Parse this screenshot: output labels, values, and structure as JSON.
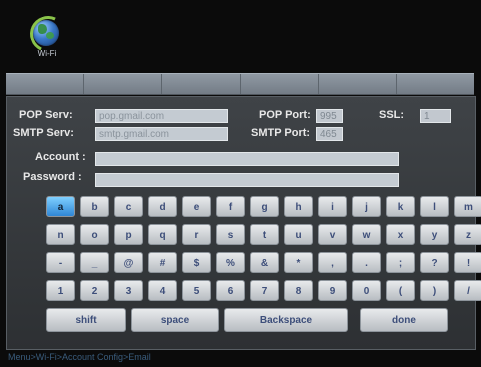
{
  "logo": {
    "label": "Wi-Fi"
  },
  "tabs": [
    "",
    "",
    "",
    "",
    "",
    ""
  ],
  "form": {
    "pop_serv_label": "POP Serv:",
    "pop_serv_value": "pop.gmail.com",
    "smtp_serv_label": "SMTP Serv:",
    "smtp_serv_value": "smtp.gmail.com",
    "pop_port_label": "POP Port:",
    "pop_port_value": "995",
    "smtp_port_label": "SMTP Port:",
    "smtp_port_value": "465",
    "ssl_label": "SSL:",
    "ssl_value": "1",
    "account_label": "Account :",
    "account_value": "",
    "password_label": "Password :",
    "password_value": ""
  },
  "keyboard": {
    "row1": [
      "a",
      "b",
      "c",
      "d",
      "e",
      "f",
      "g",
      "h",
      "i",
      "j",
      "k",
      "l",
      "m"
    ],
    "row2": [
      "n",
      "o",
      "p",
      "q",
      "r",
      "s",
      "t",
      "u",
      "v",
      "w",
      "x",
      "y",
      "z"
    ],
    "row3": [
      "-",
      "_",
      "@",
      "#",
      "$",
      "%",
      "&",
      "*",
      ",",
      ".",
      ";",
      "?",
      "!"
    ],
    "row4": [
      "1",
      "2",
      "3",
      "4",
      "5",
      "6",
      "7",
      "8",
      "9",
      "0",
      "(",
      ")",
      "/"
    ],
    "shift": "shift",
    "space": "space",
    "backspace": "Backspace",
    "done": "done",
    "selected_key": "a"
  },
  "status": {
    "breadcrumb": "Menu>Wi-Fi>Account Config>Email"
  },
  "colors": {
    "key_selected": "#2f86d6",
    "panel": "#3a3e42",
    "field": "#c4cbd2"
  }
}
